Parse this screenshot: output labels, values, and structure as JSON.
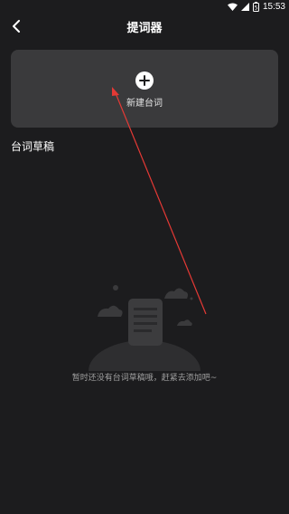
{
  "status": {
    "time": "15:53",
    "battery": "5"
  },
  "nav": {
    "title": "提词器",
    "back_icon": "chevron-left-icon"
  },
  "new_card": {
    "label": "新建台词",
    "icon": "plus-circle-icon"
  },
  "section": {
    "heading": "台词草稿"
  },
  "empty": {
    "message": "暂时还没有台词草稿哦，赶紧去添加吧~"
  },
  "colors": {
    "background": "#1c1c1e",
    "card": "#3a3a3c",
    "annotation": "#e53935"
  }
}
